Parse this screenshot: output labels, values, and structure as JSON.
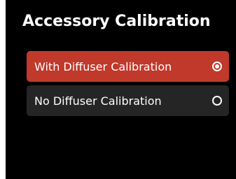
{
  "screen": {
    "title": "Accessory Calibration"
  },
  "options": [
    {
      "label": "With Diffuser Calibration",
      "selected": true
    },
    {
      "label": "No Diffuser Calibration",
      "selected": false
    }
  ],
  "colors": {
    "background": "#000000",
    "selected_option": "#c0392b",
    "unselected_option": "#252525",
    "text": "#ffffff"
  },
  "icons": {
    "selected": "radio-selected-icon",
    "unselected": "radio-unselected-icon"
  }
}
